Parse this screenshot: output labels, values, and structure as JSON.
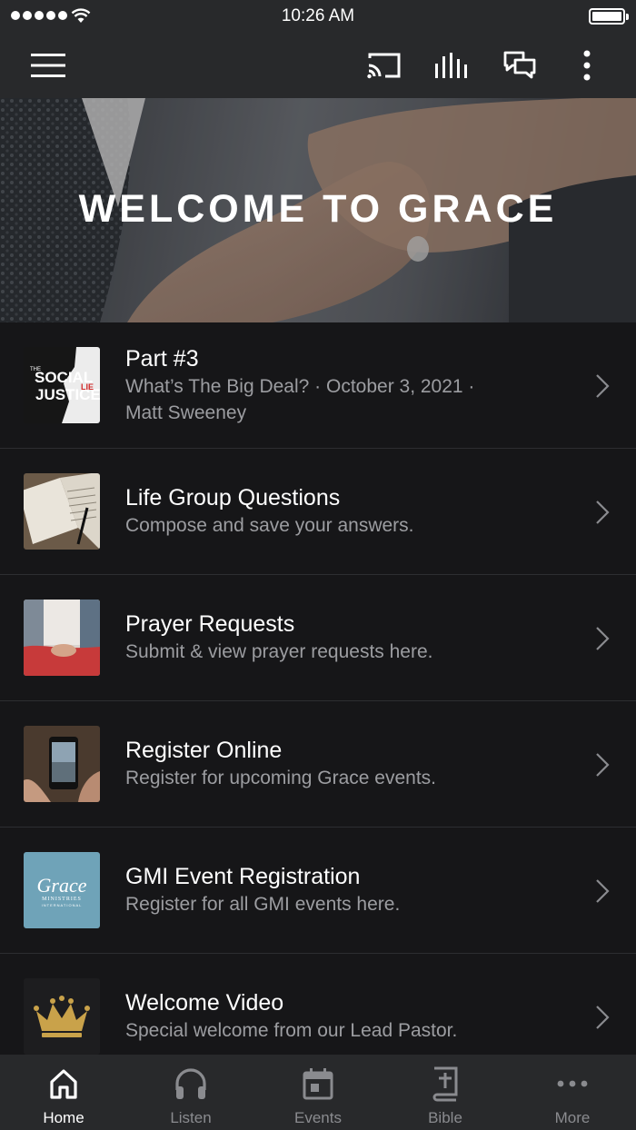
{
  "status_bar": {
    "time": "10:26 AM"
  },
  "app_bar": {
    "icons": [
      "hamburger-menu-icon",
      "cast-icon",
      "audio-bars-icon",
      "chat-icon",
      "more-vert-icon"
    ]
  },
  "hero": {
    "title": "WELCOME TO GRACE"
  },
  "list": [
    {
      "title": "Part #3",
      "subtitle_line1": "What’s The Big Deal? · October 3, 2021 ·",
      "subtitle_line2": "Matt Sweeney",
      "thumb_text_1": "THE",
      "thumb_text_2": "SOCIAL",
      "thumb_text_3": "JUSTICE",
      "thumb_text_4": "LIE"
    },
    {
      "title": "Life Group Questions",
      "subtitle_line1": "Compose and save your answers."
    },
    {
      "title": "Prayer Requests",
      "subtitle_line1": "Submit & view prayer requests here."
    },
    {
      "title": "Register Online",
      "subtitle_line1": "Register for upcoming Grace events."
    },
    {
      "title": "GMI Event Registration",
      "subtitle_line1": "Register for all GMI events here.",
      "thumb_text_1": "Grace",
      "thumb_text_2": "MINISTRIES",
      "thumb_text_3": "INTERNATIONAL"
    },
    {
      "title": "Welcome Video",
      "subtitle_line1": "Special welcome from our Lead Pastor."
    }
  ],
  "tabbar": {
    "tabs": [
      {
        "label": "Home",
        "active": true
      },
      {
        "label": "Listen"
      },
      {
        "label": "Events"
      },
      {
        "label": "Bible"
      },
      {
        "label": "More"
      }
    ]
  },
  "colors": {
    "bar_bg": "#28292b",
    "page_bg": "#161618",
    "muted_text": "#9c9da1",
    "gmi_thumb_bg": "#6fa3b8",
    "crown_gold": "#c9a24a"
  }
}
